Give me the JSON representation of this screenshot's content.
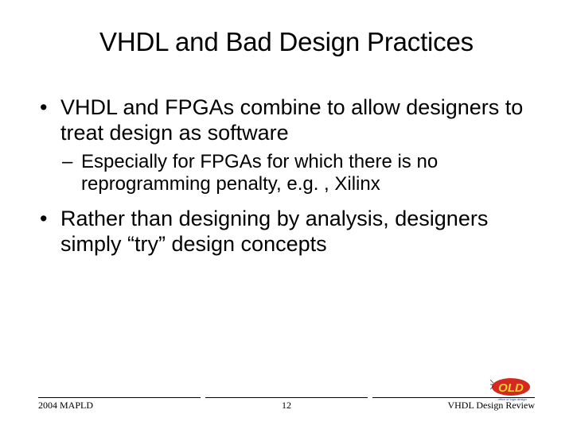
{
  "title": "VHDL and Bad Design Practices",
  "bullets": {
    "b1": "VHDL and FPGAs combine to allow designers to treat design as software",
    "b1_sub1": "Especially for FPGAs for which there is no reprogramming penalty, e.g. , Xilinx",
    "b2": "Rather than designing by analysis, designers simply “try” design concepts"
  },
  "footer": {
    "left": "2004 MAPLD",
    "center": "12",
    "right": "VHDL Design Review"
  },
  "logo": {
    "name": "OLD — Office of Logic Design",
    "colors": {
      "oval": "#d32a20",
      "letters": "#f7d233",
      "tagline": "#2a4aa0"
    }
  }
}
